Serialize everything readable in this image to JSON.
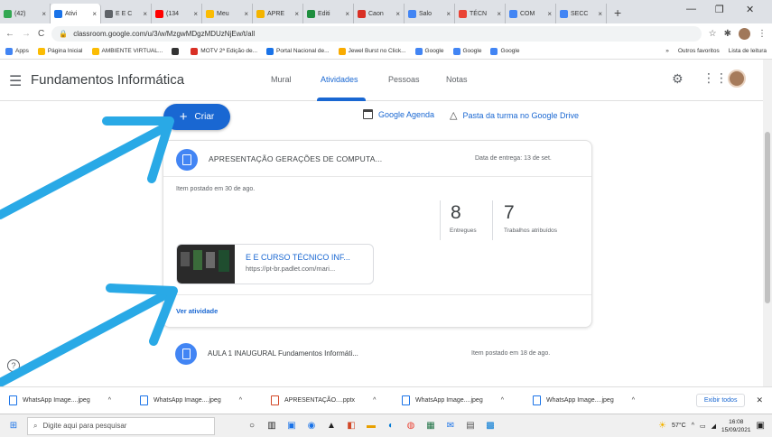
{
  "browser": {
    "tabs": [
      {
        "label": "(42)",
        "color": "#34a853",
        "active": false
      },
      {
        "label": "Ativi",
        "color": "#1a73e8",
        "active": true
      },
      {
        "label": "E E C",
        "color": "#5f6368",
        "active": false
      },
      {
        "label": "(134",
        "color": "#ff0000",
        "active": false
      },
      {
        "label": "Meu",
        "color": "#fbbc04",
        "active": false
      },
      {
        "label": "APRE",
        "color": "#f4b400",
        "active": false
      },
      {
        "label": "Editi",
        "color": "#1e8e3e",
        "active": false
      },
      {
        "label": "Caon",
        "color": "#d93025",
        "active": false
      },
      {
        "label": "Salo",
        "color": "#4285f4",
        "active": false
      },
      {
        "label": "TÉCN",
        "color": "#ea4335",
        "active": false
      },
      {
        "label": "COM",
        "color": "#4285f4",
        "active": false
      },
      {
        "label": "SECC",
        "color": "#4285f4",
        "active": false
      }
    ],
    "new_tab": "+",
    "window_controls": {
      "minimize": "—",
      "maximize": "❐",
      "close": "✕"
    },
    "url": "classroom.google.com/u/3/w/MzgwMDgzMDUzNjEw/t/all",
    "bookmarks": [
      {
        "label": "Apps",
        "color": "#4285f4"
      },
      {
        "label": "Página Inicial",
        "color": "#fbbc04"
      },
      {
        "label": "AMBIENTE VIRTUAL...",
        "color": "#fbbc04"
      },
      {
        "label": "",
        "color": "#333333"
      },
      {
        "label": "MOTV 2ª Edição de...",
        "color": "#d93025"
      },
      {
        "label": "Portal Nacional de...",
        "color": "#1a73e8"
      },
      {
        "label": "Jewel Burst no Click...",
        "color": "#f9ab00"
      },
      {
        "label": "Google",
        "color": "#4285f4"
      },
      {
        "label": "Google",
        "color": "#4285f4"
      },
      {
        "label": "Google",
        "color": "#4285f4"
      }
    ],
    "bookmarks_more": "»",
    "other_bookmarks": "Outros favoritos",
    "reading_list": "Lista de leitura"
  },
  "classroom": {
    "title": "Fundamentos Informática",
    "tabs": [
      {
        "label": "Mural",
        "active": false
      },
      {
        "label": "Atividades",
        "active": true
      },
      {
        "label": "Pessoas",
        "active": false
      },
      {
        "label": "Notas",
        "active": false
      }
    ],
    "create_button": "Criar",
    "calendar_link": "Google Agenda",
    "drive_link": "Pasta da turma no Google Drive",
    "assignment": {
      "title": "APRESENTAÇÃO GERAÇÕES DE COMPUTA...",
      "due": "Data de entrega: 13 de set.",
      "posted": "Item postado em 30 de ago.",
      "delivered_count": "8",
      "delivered_label": "Entregues",
      "assigned_count": "7",
      "assigned_label": "Trabalhos atribuídos",
      "attachment_title": "E E CURSO TÉCNICO INF...",
      "attachment_url": "https://pt-br.padlet.com/mari...",
      "view_link": "Ver atividade"
    },
    "material": {
      "title": "AULA 1 INAUGURAL Fundamentos Informáti...",
      "posted": "Item postado em 18 de ago."
    },
    "help": "?"
  },
  "downloads": {
    "items": [
      "WhatsApp Image....jpeg",
      "WhatsApp Image....jpeg",
      "APRESENTAÇÃO....pptx",
      "WhatsApp Image....jpeg",
      "WhatsApp Image....jpeg"
    ],
    "show_all": "Exibir todos"
  },
  "taskbar": {
    "search_placeholder": "Digite aqui para pesquisar",
    "weather": "57°C",
    "time": "16:08",
    "date": "15/09/2021"
  },
  "colors": {
    "accent": "#1967d2",
    "arrow": "#29a9e6",
    "classroom_blue": "#4285f4"
  }
}
